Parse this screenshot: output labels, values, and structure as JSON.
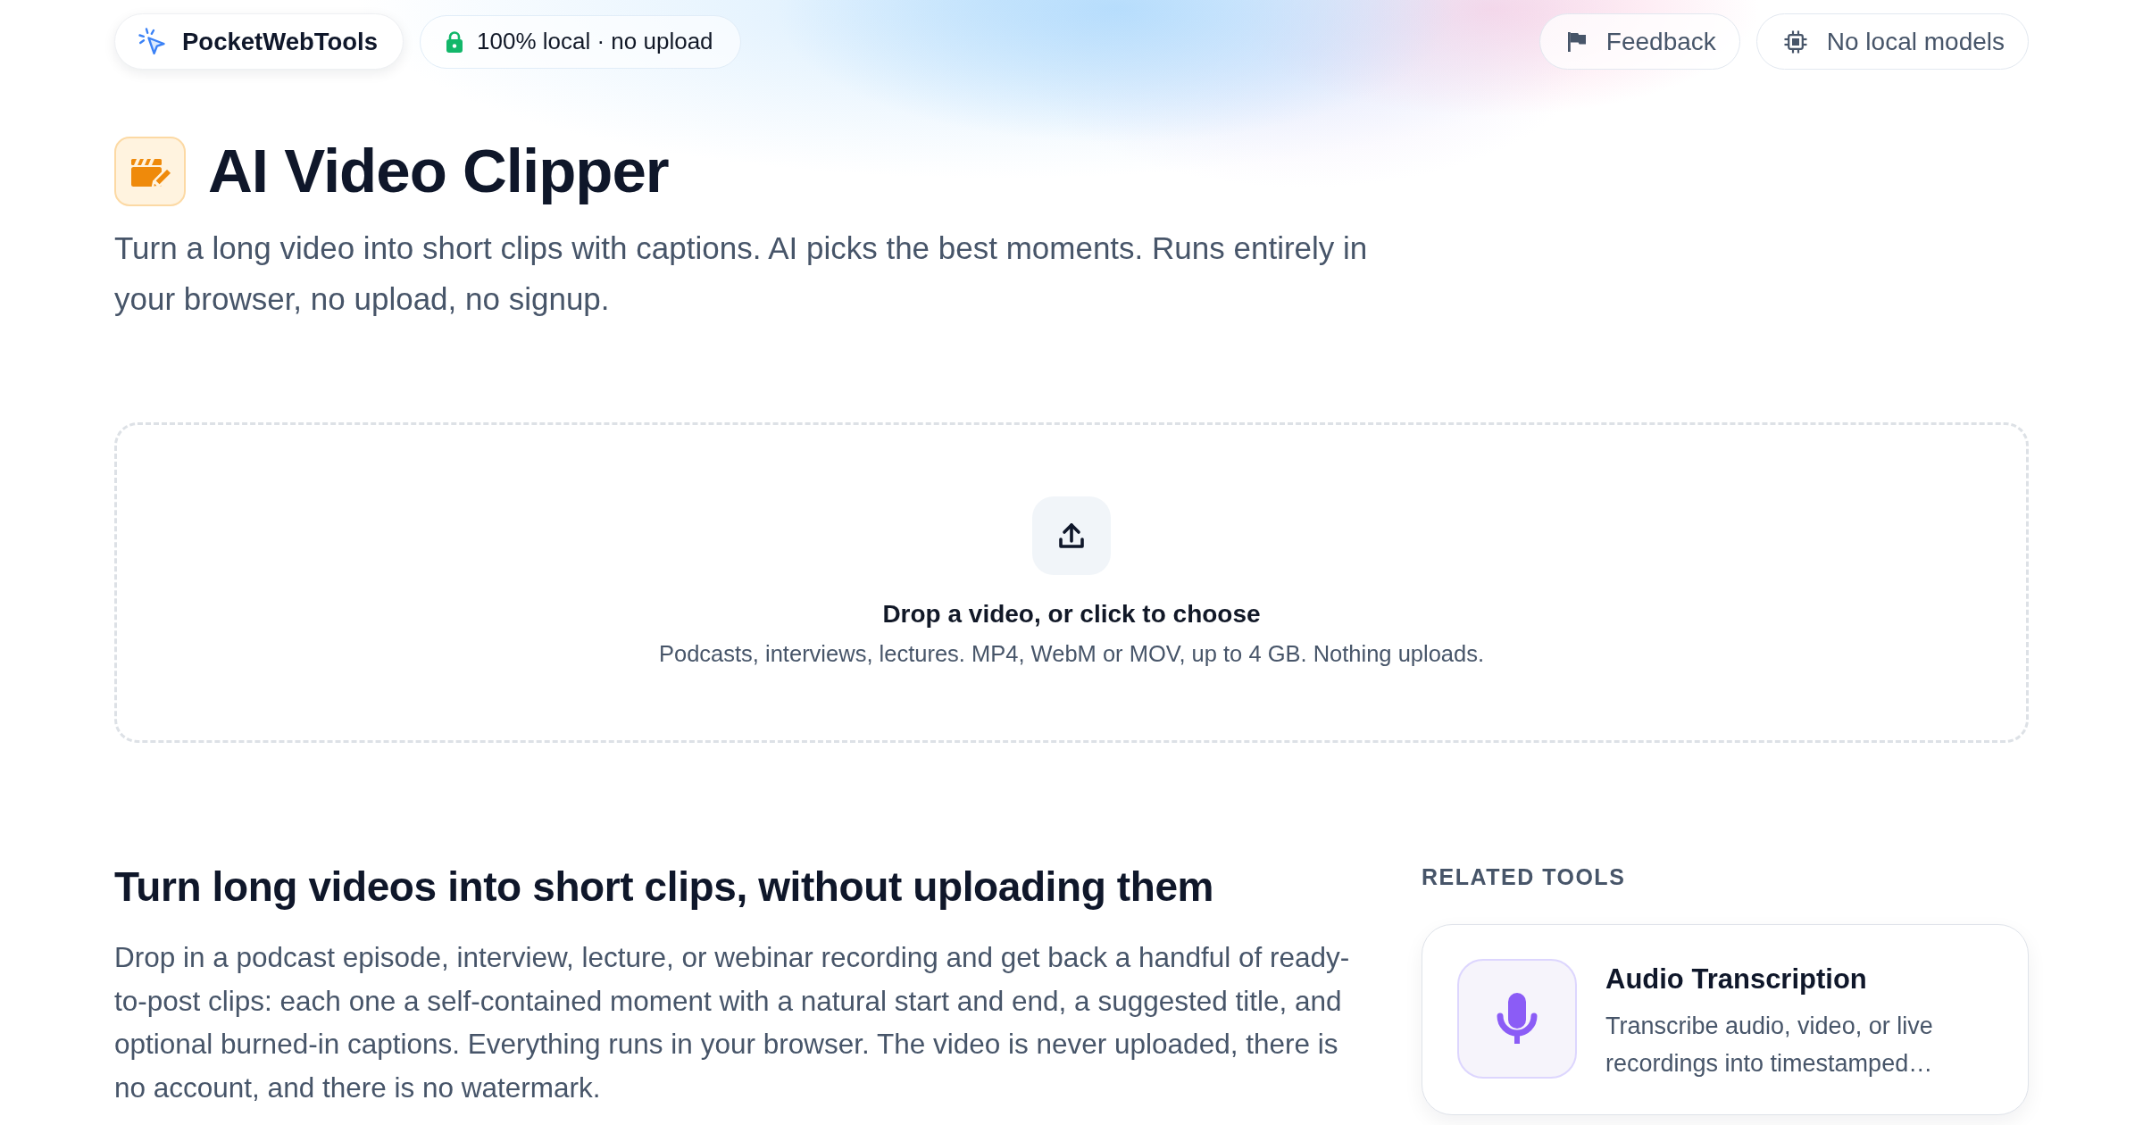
{
  "header": {
    "brand": "PocketWebTools",
    "privacy_badge": "100% local · no upload",
    "actions": [
      {
        "kind": "feedback",
        "label": "Feedback"
      },
      {
        "kind": "models",
        "label": "No local models"
      }
    ]
  },
  "tool": {
    "title": "AI Video Clipper",
    "description": "Turn a long video into short clips with captions. AI picks the best moments. Runs entirely in your browser, no upload, no signup."
  },
  "dropzone": {
    "title": "Drop a video, or click to choose",
    "hint": "Podcasts, interviews, lectures. MP4, WebM or MOV, up to 4 GB. Nothing uploads."
  },
  "article": {
    "heading": "Turn long videos into short clips, without uploading them",
    "body": "Drop in a podcast episode, interview, lecture, or webinar recording and get back a handful of ready-to-post clips: each one a self-contained moment with a natural start and end, a suggested title, and optional burned-in captions. Everything runs in your browser. The video is never uploaded, there is no account, and there is no watermark."
  },
  "related_tools": {
    "heading": "RELATED TOOLS",
    "tools": [
      {
        "name": "Audio Transcription",
        "description": "Transcribe audio, video, or live recordings into timestamped…"
      }
    ]
  }
}
